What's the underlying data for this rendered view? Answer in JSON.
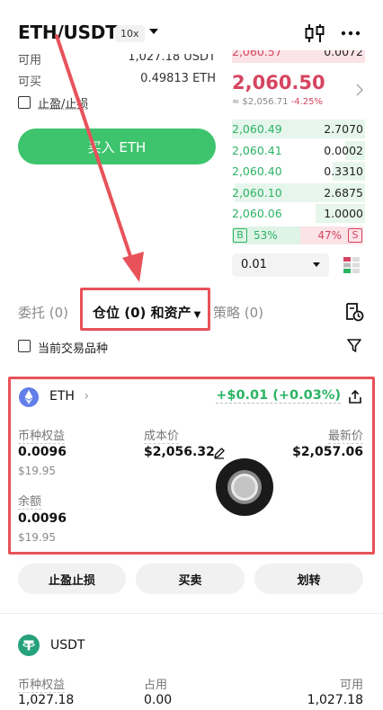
{
  "header": {
    "pair": "ETH/USDT",
    "leverage": "10x",
    "chart_icon": "candlestick-icon",
    "more_icon": "more-dots-icon"
  },
  "trade": {
    "available_label": "可用",
    "available_value": "1,027.18 USDT",
    "can_buy_label": "可买",
    "can_buy_value": "0.49813 ETH",
    "tpsl_label": "止盈/止损",
    "buy_button": "买入 ETH"
  },
  "orderbook": {
    "top_ask_partial": "2,060.57",
    "top_ask_qty_partial": "0.0072",
    "last_price": "2,060.50",
    "approx_usd": "≈ $2,056.71",
    "change_pct": "-4.25%",
    "bids": [
      {
        "price": "2,060.49",
        "qty": "2.7070",
        "depth": 1.0
      },
      {
        "price": "2,060.41",
        "qty": "0.0002",
        "depth": 0.15
      },
      {
        "price": "2,060.40",
        "qty": "0.3310",
        "depth": 0.24
      },
      {
        "price": "2,060.10",
        "qty": "2.6875",
        "depth": 0.98
      },
      {
        "price": "2,060.06",
        "qty": "1.0000",
        "depth": 0.37
      }
    ],
    "buy_tag": "B",
    "buy_pct": "53%",
    "sell_pct": "47%",
    "sell_tag": "S",
    "step_value": "0.01"
  },
  "tabs": {
    "orders": "委托 (0)",
    "positions": "仓位 (0) 和资产",
    "strategies": "策略 (0)"
  },
  "filter": {
    "current_pair_label": "当前交易品种"
  },
  "eth_card": {
    "asset": "ETH",
    "pnl": "+$0.01 (+0.03%)",
    "equity_label": "币种权益",
    "equity_value": "0.0096",
    "equity_usd": "$19.95",
    "cost_label": "成本价",
    "cost_value": "$2,056.32",
    "last_label": "最新价",
    "last_value": "$2,057.06",
    "balance_label": "余额",
    "balance_value": "0.0096",
    "balance_usd": "$19.95"
  },
  "actions": {
    "tpsl": "止盈止损",
    "trade": "买卖",
    "transfer": "划转"
  },
  "usdt_card": {
    "asset": "USDT",
    "equity_label": "币种权益",
    "equity_value": "1,027.18",
    "used_label": "占用",
    "used_value": "0.00",
    "avail_label": "可用",
    "avail_value": "1,027.18"
  },
  "colors": {
    "green": "#2bb364",
    "red": "#d64560",
    "buy_button": "#3ec46d",
    "annotation": "#e8525a"
  }
}
